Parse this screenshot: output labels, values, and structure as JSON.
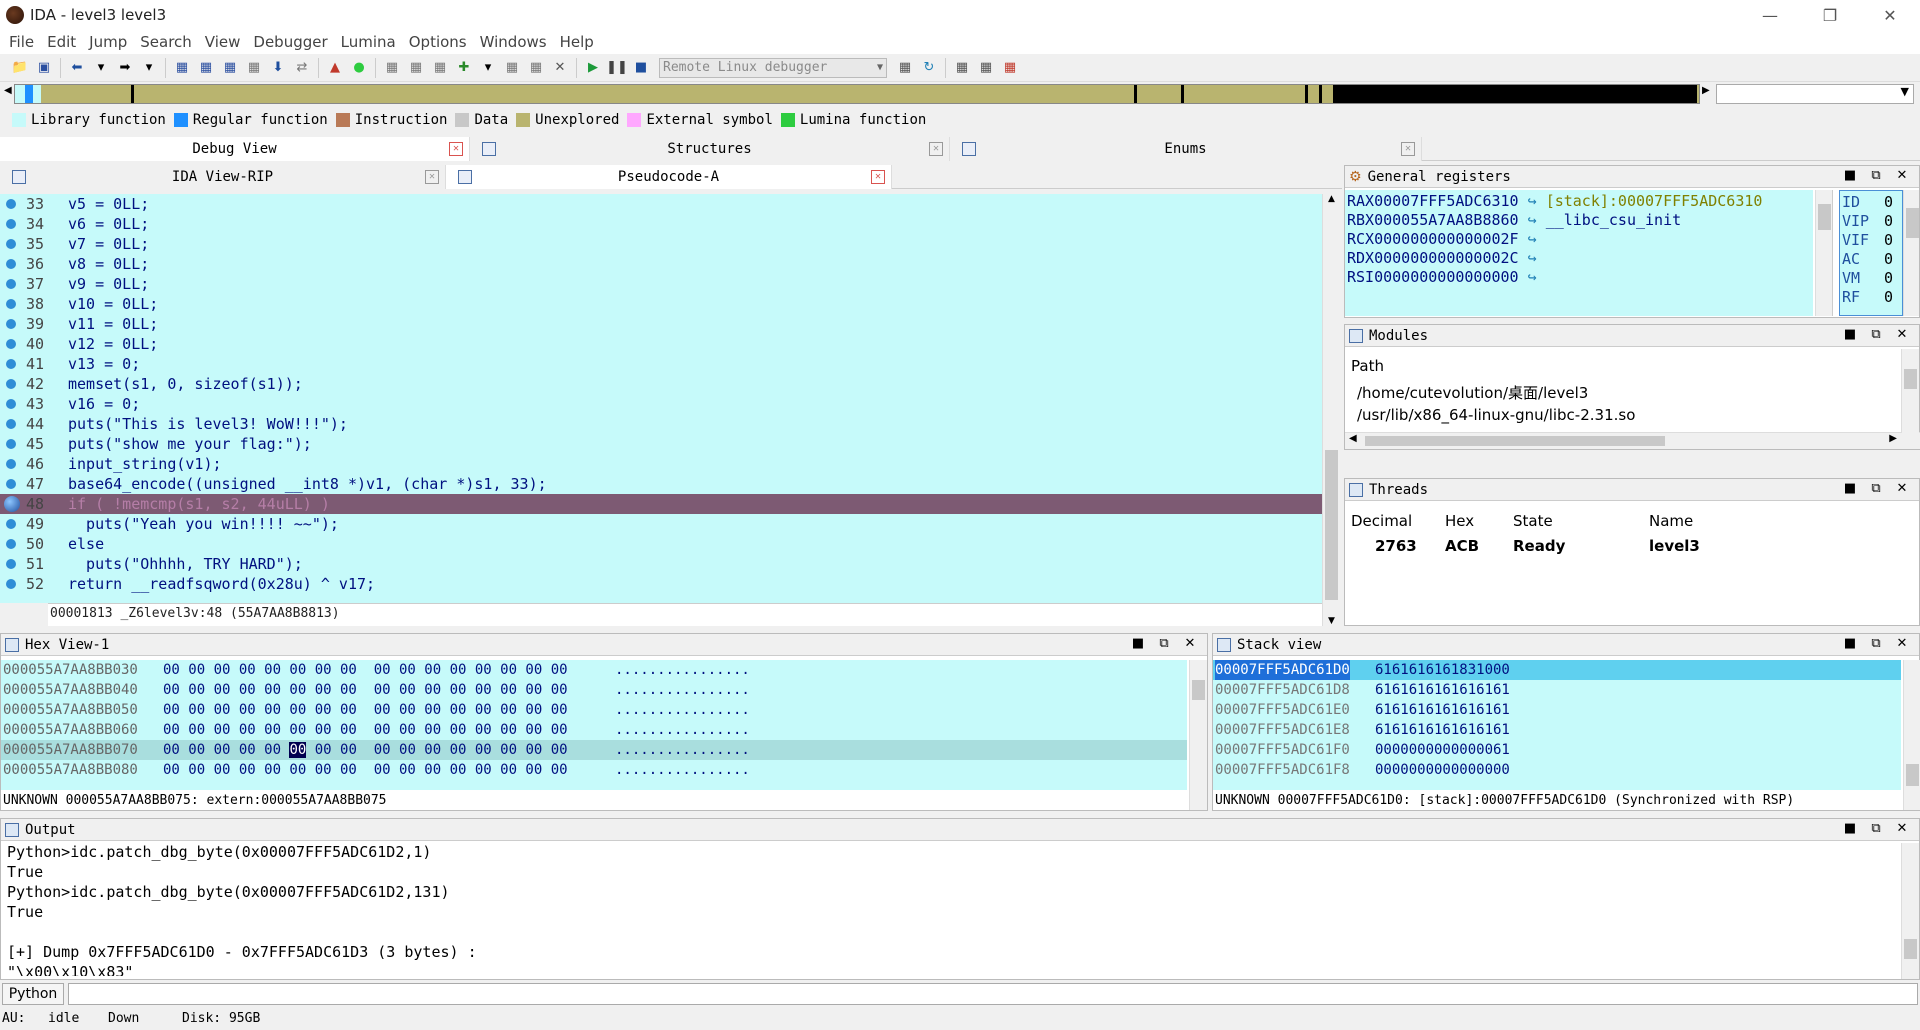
{
  "window": {
    "title": "IDA - level3 level3"
  },
  "menu": [
    "File",
    "Edit",
    "Jump",
    "Search",
    "View",
    "Debugger",
    "Lumina",
    "Options",
    "Windows",
    "Help"
  ],
  "toolbar": {
    "debugger_select": "Remote Linux debugger"
  },
  "legend": [
    {
      "label": "Library function",
      "color": "#c6fafa"
    },
    {
      "label": "Regular function",
      "color": "#1e90ff"
    },
    {
      "label": "Instruction",
      "color": "#b97a57"
    },
    {
      "label": "Data",
      "color": "#c8c8c8"
    },
    {
      "label": "Unexplored",
      "color": "#b9b46f"
    },
    {
      "label": "External symbol",
      "color": "#ffa8ff"
    },
    {
      "label": "Lumina function",
      "color": "#2ecc40"
    }
  ],
  "tabs_top": [
    "Debug View",
    "Structures",
    "Enums"
  ],
  "tabs_code": [
    "IDA View-RIP",
    "Pseudocode-A"
  ],
  "code": {
    "lines": [
      {
        "n": "33",
        "t": "v5 = 0LL;"
      },
      {
        "n": "34",
        "t": "v6 = 0LL;"
      },
      {
        "n": "35",
        "t": "v7 = 0LL;"
      },
      {
        "n": "36",
        "t": "v8 = 0LL;"
      },
      {
        "n": "37",
        "t": "v9 = 0LL;"
      },
      {
        "n": "38",
        "t": "v10 = 0LL;"
      },
      {
        "n": "39",
        "t": "v11 = 0LL;"
      },
      {
        "n": "40",
        "t": "v12 = 0LL;"
      },
      {
        "n": "41",
        "t": "v13 = 0;"
      },
      {
        "n": "42",
        "t": "memset(s1, 0, sizeof(s1));"
      },
      {
        "n": "43",
        "t": "v16 = 0;"
      },
      {
        "n": "44",
        "t": "puts(\"This is level3! WoW!!!\");"
      },
      {
        "n": "45",
        "t": "puts(\"show me your flag:\");"
      },
      {
        "n": "46",
        "t": "input_string(v1);"
      },
      {
        "n": "47",
        "t": "base64_encode((unsigned __int8 *)v1, (char *)s1, 33);"
      },
      {
        "n": "48",
        "t": "if ( !memcmp(s1, s2, 44uLL) )"
      },
      {
        "n": "49",
        "t": "  puts(\"Yeah you win!!!! ~~\");"
      },
      {
        "n": "50",
        "t": "else"
      },
      {
        "n": "51",
        "t": "  puts(\"Ohhhh, TRY HARD\");"
      },
      {
        "n": "52",
        "t": "return __readfsqword(0x28u) ^ v17;"
      }
    ],
    "status": "00001813 _Z6level3v:48 (55A7AA8B8813)"
  },
  "registers": {
    "title": "General registers",
    "rows": [
      {
        "name": "RAX",
        "value": "00007FFF5ADC6310",
        "ref": "[stack]:00007FFF5ADC6310"
      },
      {
        "name": "RBX",
        "value": "000055A7AA8B8860",
        "ref": "__libc_csu_init"
      },
      {
        "name": "RCX",
        "value": "000000000000002F",
        "ref": ""
      },
      {
        "name": "RDX",
        "value": "000000000000002C",
        "ref": ""
      },
      {
        "name": "RSI",
        "value": "0000000000000000",
        "ref": ""
      }
    ],
    "flags": [
      {
        "name": "ID",
        "value": "0"
      },
      {
        "name": "VIP",
        "value": "0"
      },
      {
        "name": "VIF",
        "value": "0"
      },
      {
        "name": "AC",
        "value": "0"
      },
      {
        "name": "VM",
        "value": "0"
      },
      {
        "name": "RF",
        "value": "0"
      }
    ]
  },
  "modules": {
    "title": "Modules",
    "header": "Path",
    "items": [
      "/home/cutevolution/桌面/level3",
      "/usr/lib/x86_64-linux-gnu/libc-2.31.so"
    ]
  },
  "threads": {
    "title": "Threads",
    "headers": [
      "Decimal",
      "Hex",
      "State",
      "Name"
    ],
    "row": {
      "decimal": "2763",
      "hex": "ACB",
      "state": "Ready",
      "name": "level3"
    }
  },
  "hex": {
    "title": "Hex View-1",
    "rows": [
      {
        "addr": "000055A7AA8BB030",
        "bytes": "00 00 00 00 00 00 00 00  00 00 00 00 00 00 00 00",
        "ascii": "................"
      },
      {
        "addr": "000055A7AA8BB040",
        "bytes": "00 00 00 00 00 00 00 00  00 00 00 00 00 00 00 00",
        "ascii": "................"
      },
      {
        "addr": "000055A7AA8BB050",
        "bytes": "00 00 00 00 00 00 00 00  00 00 00 00 00 00 00 00",
        "ascii": "................"
      },
      {
        "addr": "000055A7AA8BB060",
        "bytes": "00 00 00 00 00 00 00 00  00 00 00 00 00 00 00 00",
        "ascii": "................"
      },
      {
        "addr": "000055A7AA8BB070",
        "bytes": "00 00 00 00 00 00 00 00  00 00 00 00 00 00 00 00",
        "ascii": "................"
      },
      {
        "addr": "000055A7AA8BB080",
        "bytes": "00 00 00 00 00 00 00 00  00 00 00 00 00 00 00 00",
        "ascii": "................"
      }
    ],
    "status": "UNKNOWN 000055A7AA8BB075: extern:000055A7AA8BB075"
  },
  "stack": {
    "title": "Stack view",
    "rows": [
      {
        "addr": "00007FFF5ADC61D0",
        "val": "6161616161831000"
      },
      {
        "addr": "00007FFF5ADC61D8",
        "val": "6161616161616161"
      },
      {
        "addr": "00007FFF5ADC61E0",
        "val": "6161616161616161"
      },
      {
        "addr": "00007FFF5ADC61E8",
        "val": "6161616161616161"
      },
      {
        "addr": "00007FFF5ADC61F0",
        "val": "0000000000000061"
      },
      {
        "addr": "00007FFF5ADC61F8",
        "val": "0000000000000000"
      }
    ],
    "status": "UNKNOWN 00007FFF5ADC61D0: [stack]:00007FFF5ADC61D0 (Synchronized with RSP)"
  },
  "output": {
    "title": "Output",
    "lines": [
      "Python>idc.patch_dbg_byte(0x00007FFF5ADC61D2,1)",
      "True",
      "Python>idc.patch_dbg_byte(0x00007FFF5ADC61D2,131)",
      "True",
      "",
      "[+] Dump 0x7FFF5ADC61D0 - 0x7FFF5ADC61D3 (3 bytes) :",
      "\"\\x00\\x10\\x83\""
    ],
    "interpreter": "Python"
  },
  "statusbar": {
    "au": "AU:",
    "state": "idle",
    "dir": "Down",
    "disk": "Disk: 95GB"
  }
}
